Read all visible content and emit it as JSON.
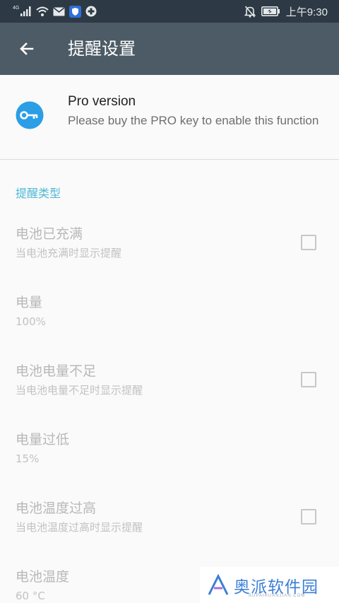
{
  "status_bar": {
    "network": "4G",
    "time": "上午9:30",
    "icons": [
      "signal-icon",
      "wifi-icon",
      "mail-icon",
      "shield-icon",
      "plus-circle-icon",
      "bell-off-icon",
      "battery-icon"
    ]
  },
  "toolbar": {
    "back_icon": "arrow-left-icon",
    "title": "提醒设置"
  },
  "pro": {
    "icon": "key-icon",
    "title": "Pro version",
    "description": "Please buy the PRO key to enable this function"
  },
  "category": {
    "label": "提醒类型"
  },
  "preferences": [
    {
      "title": "电池已充满",
      "summary": "当电池充满时显示提醒",
      "checked": false,
      "has_checkbox": true
    },
    {
      "title": "电量",
      "summary": "100%",
      "has_checkbox": false
    },
    {
      "title": "电池电量不足",
      "summary": "当电池电量不足时显示提醒",
      "checked": false,
      "has_checkbox": true
    },
    {
      "title": "电量过低",
      "summary": "15%",
      "has_checkbox": false
    },
    {
      "title": "电池温度过高",
      "summary": "当电池温度过高时显示提醒",
      "checked": false,
      "has_checkbox": true
    },
    {
      "title": "电池温度",
      "summary": "60 °C",
      "has_checkbox": false
    }
  ],
  "watermark": {
    "text": "奥派软件园",
    "sub": "AUPAIRUANJIAN.COM",
    "color": "#3a7fd6"
  },
  "colors": {
    "status_bar": "#2d3a45",
    "toolbar": "#4c5b66",
    "accent": "#4fb8d6",
    "key_circle": "#2b9ee6"
  }
}
